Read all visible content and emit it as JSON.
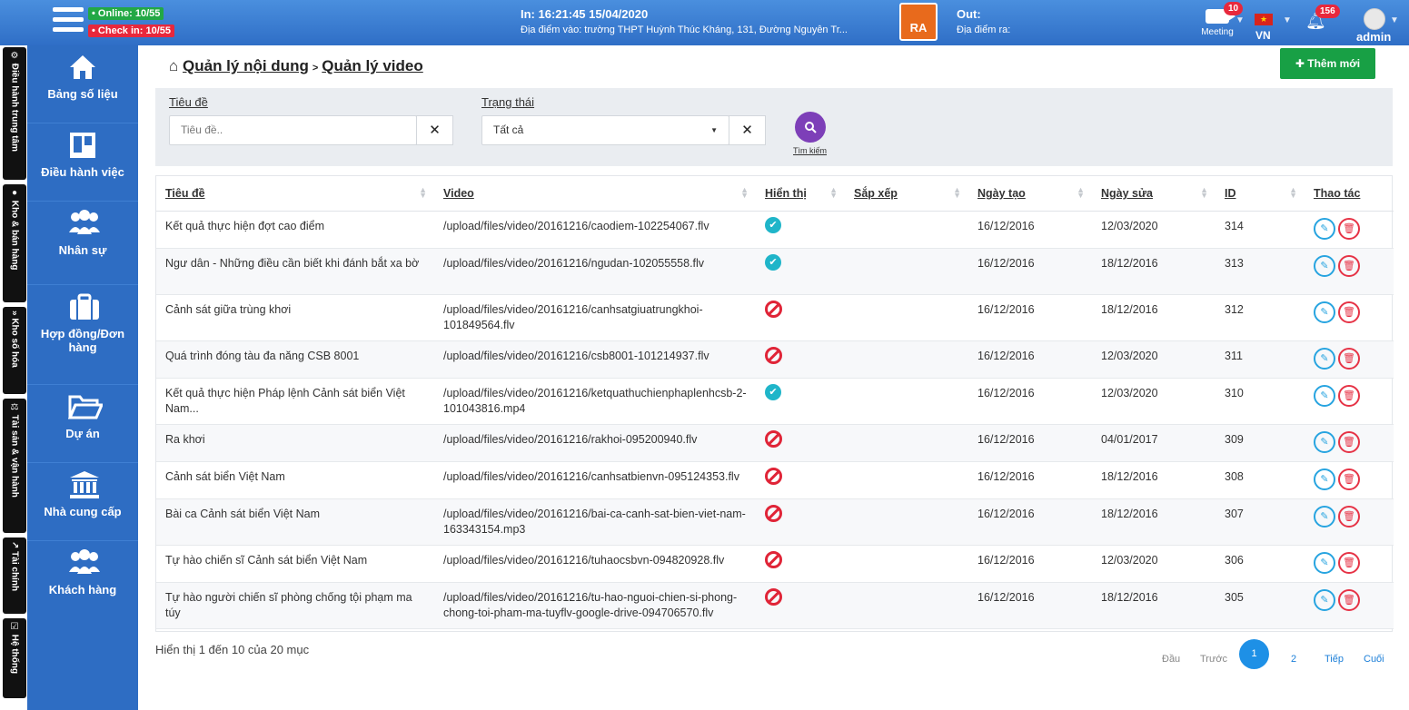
{
  "topbar": {
    "online": "• Online: 10/55",
    "checkin": "• Check in: 10/55",
    "in_time": "In: 16:21:45 15/04/2020",
    "in_place": "Địa điểm vào: trường THPT Huỳnh Thúc Kháng, 131, Đường Nguyễn Tr...",
    "logo_text": "RA",
    "out_label": "Out:",
    "out_place": "Địa điểm ra:",
    "meeting_label": "Meeting",
    "meeting_count": "10",
    "language": "VN",
    "notification_count": "156",
    "user": "admin"
  },
  "vertical_tabs": [
    "⚙ Điều hành trung tâm",
    "● Kho & bán hàng",
    "» Kho số hóa",
    "⚖ Tài sản & vận hành",
    "↗ Tài chính",
    "☑ Hệ thống"
  ],
  "sidebar": [
    {
      "label": "Bảng số liệu",
      "icon": "home-icon"
    },
    {
      "label": "Điều hành việc",
      "icon": "board-icon"
    },
    {
      "label": "Nhân sự",
      "icon": "users-icon"
    },
    {
      "label": "Hợp đồng/Đơn hàng",
      "icon": "briefcase-icon"
    },
    {
      "label": "Dự án",
      "icon": "folder-icon"
    },
    {
      "label": "Nhà cung cấp",
      "icon": "bank-icon"
    },
    {
      "label": "Khách hàng",
      "icon": "users-icon"
    }
  ],
  "breadcrumb": {
    "root": "Quản lý nội dung",
    "current": "Quản lý video"
  },
  "add_button": "Thêm mới",
  "filter": {
    "title_label": "Tiêu đề",
    "title_placeholder": "Tiêu đề..",
    "status_label": "Trạng thái",
    "status_value": "Tất cả",
    "search_label": "Tìm kiếm"
  },
  "table": {
    "headers": [
      "Tiêu đề",
      "Video",
      "Hiển thị",
      "Sắp xếp",
      "Ngày tạo",
      "Ngày sửa",
      "ID",
      "Thao tác"
    ],
    "rows": [
      {
        "title": "Kết quả thực hiện đợt cao điểm",
        "video": "/upload/files/video/20161216/caodiem-102254067.flv",
        "visible": true,
        "created": "16/12/2016",
        "modified": "12/03/2020",
        "id": "314"
      },
      {
        "title": "Ngư dân - Những điều cần biết khi đánh bắt xa bờ",
        "video": "/upload/files/video/20161216/ngudan-102055558.flv",
        "visible": true,
        "created": "16/12/2016",
        "modified": "18/12/2016",
        "id": "313"
      },
      {
        "title": "Cảnh sát giữa trùng khơi",
        "video": "/upload/files/video/20161216/canhsatgiuatrungkhoi-101849564.flv",
        "visible": false,
        "created": "16/12/2016",
        "modified": "18/12/2016",
        "id": "312"
      },
      {
        "title": "Quá trình đóng tàu đa năng CSB 8001",
        "video": "/upload/files/video/20161216/csb8001-101214937.flv",
        "visible": false,
        "created": "16/12/2016",
        "modified": "12/03/2020",
        "id": "311"
      },
      {
        "title": "Kết quả thực hiện Pháp lệnh Cảnh sát biển Việt Nam...",
        "video": "/upload/files/video/20161216/ketquathuchienphaplenhcsb-2-101043816.mp4",
        "visible": true,
        "created": "16/12/2016",
        "modified": "12/03/2020",
        "id": "310"
      },
      {
        "title": "Ra khơi",
        "video": "/upload/files/video/20161216/rakhoi-095200940.flv",
        "visible": false,
        "created": "16/12/2016",
        "modified": "04/01/2017",
        "id": "309"
      },
      {
        "title": "Cảnh sát biển Việt Nam",
        "video": "/upload/files/video/20161216/canhsatbienvn-095124353.flv",
        "visible": false,
        "created": "16/12/2016",
        "modified": "18/12/2016",
        "id": "308"
      },
      {
        "title": "Bài ca Cảnh sát biển Việt Nam",
        "video": "/upload/files/video/20161216/bai-ca-canh-sat-bien-viet-nam-163343154.mp3",
        "visible": false,
        "created": "16/12/2016",
        "modified": "18/12/2016",
        "id": "307"
      },
      {
        "title": "Tự hào chiến sĩ Cảnh sát biển Việt Nam",
        "video": "/upload/files/video/20161216/tuhaocsbvn-094820928.flv",
        "visible": false,
        "created": "16/12/2016",
        "modified": "12/03/2020",
        "id": "306"
      },
      {
        "title": "Tự hào người chiến sĩ phòng chống tội phạm ma túy",
        "video": "/upload/files/video/20161216/tu-hao-nguoi-chien-si-phong-chong-toi-pham-ma-tuyflv-google-drive-094706570.flv",
        "visible": false,
        "created": "16/12/2016",
        "modified": "18/12/2016",
        "id": "305"
      }
    ]
  },
  "pagination": {
    "info": "Hiển thị 1 đến 10 của 20 mục",
    "first": "Đầu",
    "prev": "Trước",
    "current": "1",
    "page2": "2",
    "next": "Tiếp",
    "last": "Cuối"
  },
  "colors": {
    "topbar": "#2f6ec6",
    "sidebar": "#2e6dc3",
    "add_button": "#18a045",
    "search_button": "#7d3fb8",
    "visible_ok": "#1fb5c9",
    "hidden": "#e02437"
  }
}
